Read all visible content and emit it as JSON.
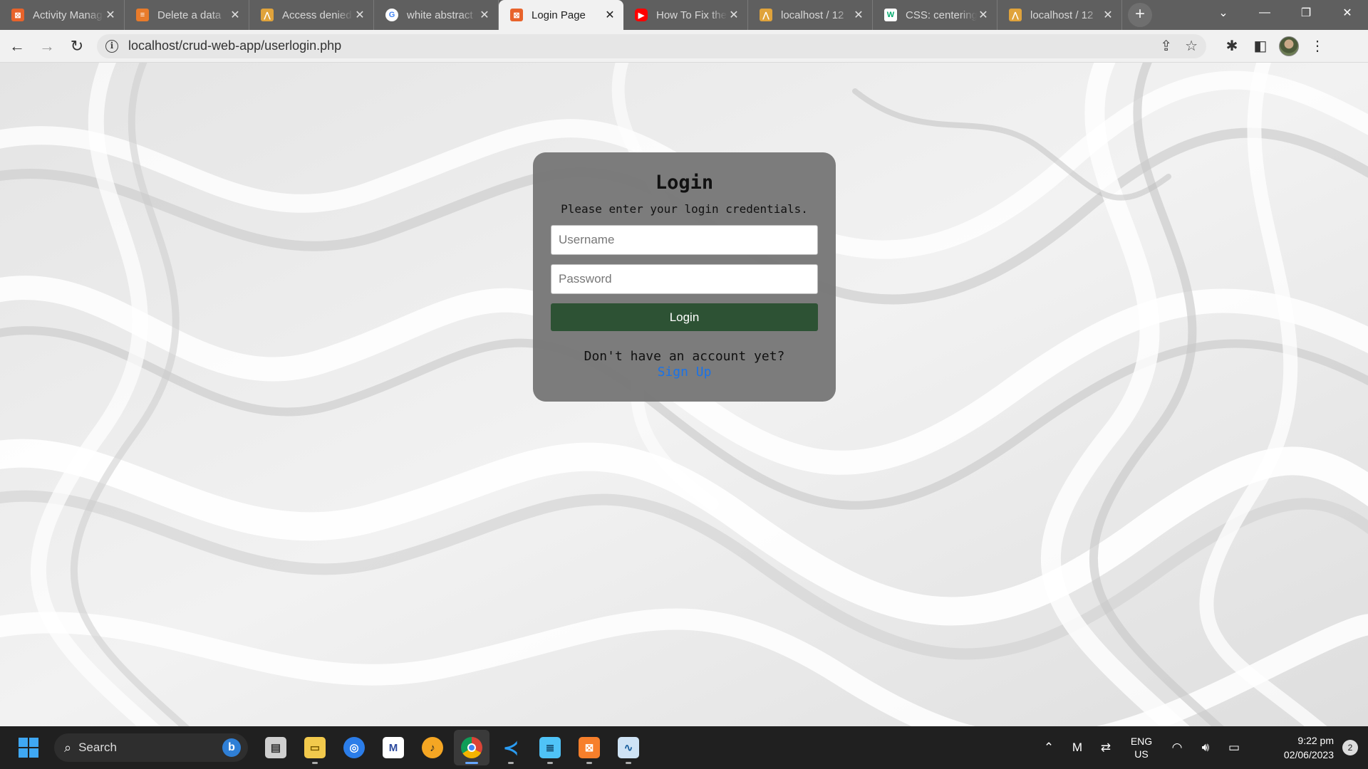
{
  "browser": {
    "tabs": [
      {
        "title": "Activity Manag",
        "favicon": "xampp-icon",
        "color": "#e8632b",
        "active": false
      },
      {
        "title": "Delete a data",
        "favicon": "stackoverflow-icon",
        "color": "#e87b2b",
        "active": false
      },
      {
        "title": "Access denied",
        "favicon": "phpmyadmin-icon",
        "color": "#e0a33b",
        "active": false
      },
      {
        "title": "white abstract",
        "favicon": "google-icon",
        "color": "#ffffff",
        "active": false
      },
      {
        "title": "Login Page",
        "favicon": "xampp-icon",
        "color": "#e8632b",
        "active": true
      },
      {
        "title": "How To Fix the",
        "favicon": "youtube-icon",
        "color": "#ff0000",
        "active": false
      },
      {
        "title": "localhost / 12",
        "favicon": "phpmyadmin-icon",
        "color": "#e0a33b",
        "active": false
      },
      {
        "title": "CSS: centering",
        "favicon": "w3schools-icon",
        "color": "#ffffff",
        "active": false
      },
      {
        "title": "localhost / 12",
        "favicon": "phpmyadmin-icon",
        "color": "#e0a33b",
        "active": false
      }
    ],
    "new_tab": "+",
    "address": "localhost/crud-web-app/userlogin.php"
  },
  "login": {
    "title": "Login",
    "subtitle": "Please enter your login credentials.",
    "username_placeholder": "Username",
    "password_placeholder": "Password",
    "button_label": "Login",
    "no_account_text": "Don't have an account yet?",
    "signup_link": "Sign Up"
  },
  "taskbar": {
    "search_label": "Search",
    "apps": [
      "task-view-icon",
      "file-explorer-icon",
      "messenger-icon",
      "mail-icon",
      "fl-studio-icon",
      "chrome-icon",
      "vscode-icon",
      "notepad-icon",
      "xampp-icon",
      "resource-monitor-icon"
    ],
    "lang_line1": "ENG",
    "lang_line2": "US",
    "time": "9:22 pm",
    "date": "02/06/2023",
    "notification_count": "2"
  }
}
